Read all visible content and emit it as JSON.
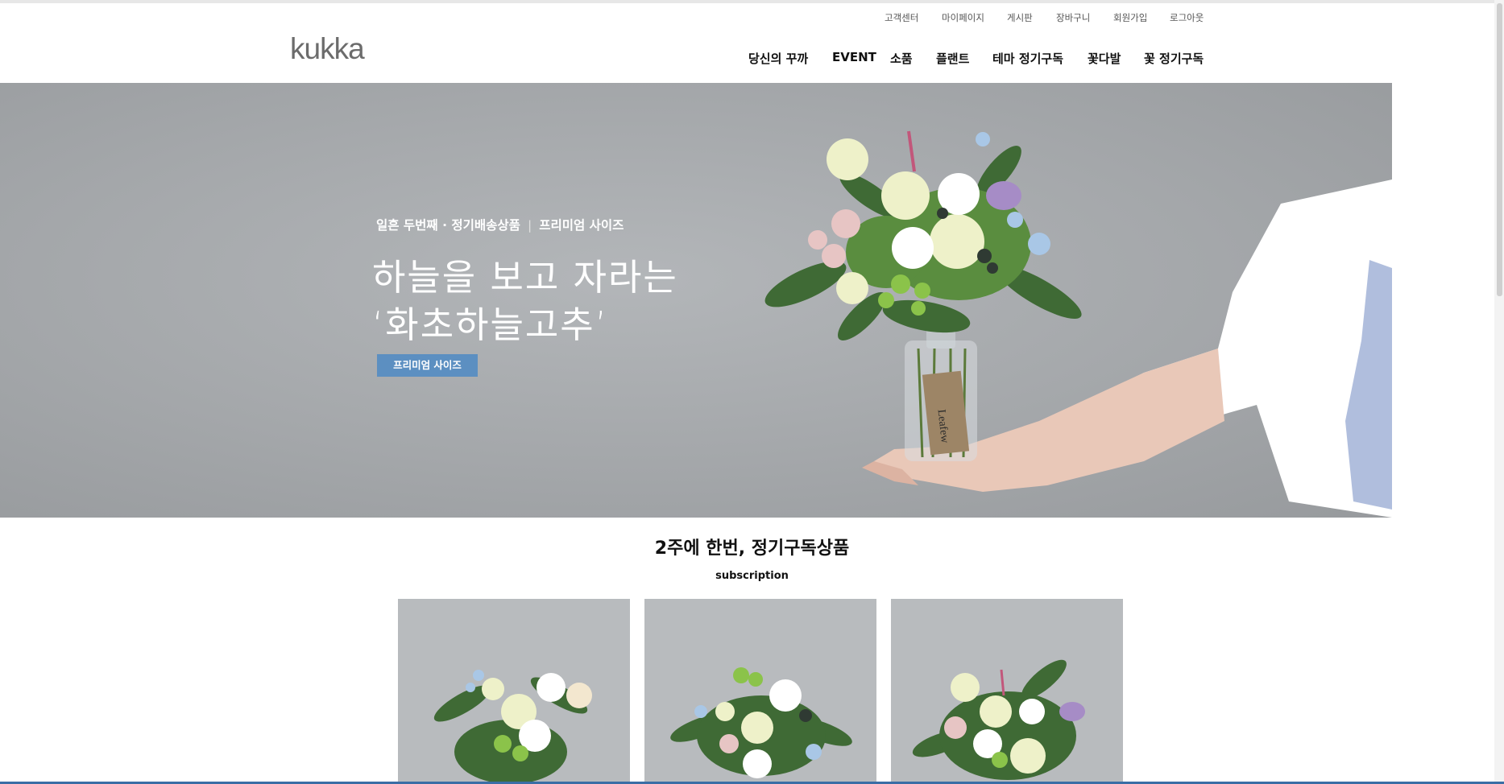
{
  "util_nav": [
    "고객센터",
    "마이페이지",
    "게시판",
    "장바구니",
    "회원가입",
    "로그아웃"
  ],
  "logo": "kukka",
  "main_nav": [
    "당신의 꾸까",
    "EVENT",
    "소품",
    "플랜트",
    "테마 정기구독",
    "꽃다발",
    "꽃 정기구독"
  ],
  "hero": {
    "sub_left": "일흔 두번째 · 정기배송상품",
    "sub_sep": "|",
    "sub_right": "프리미엄 사이즈",
    "title_line1": "하늘을 보고 자라는",
    "title_line2": "‘화초하늘고추’",
    "button_label": "프리미엄 사이즈",
    "tag_text": "Leafew"
  },
  "section": {
    "title": "2주에 한번, 정기구독상품",
    "subtitle": "subscription"
  },
  "colors": {
    "hero_bg": "#a5a8ab",
    "button_bg": "#5c8fc1",
    "card_bg": "#b8bbbe"
  }
}
